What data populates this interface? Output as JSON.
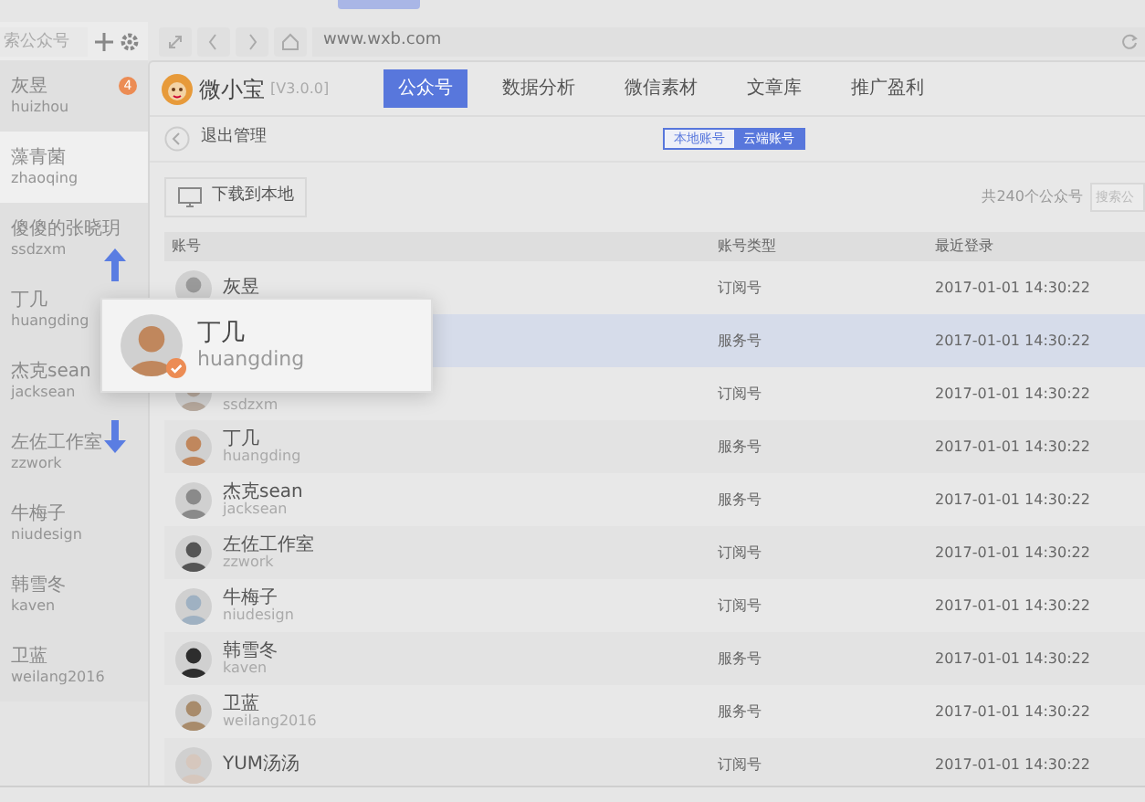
{
  "browser": {
    "url": "www.wxb.com"
  },
  "sidebar": {
    "search": {
      "placeholder": "索公众号"
    },
    "items": [
      {
        "name": "灰昱",
        "username": "huizhou",
        "badge": "4",
        "selected": false
      },
      {
        "name": "藻青菌",
        "username": "zhaoqing",
        "selected": true
      },
      {
        "name": "傻傻的张晓玥",
        "username": "ssdzxm",
        "selected": false
      },
      {
        "name": "丁几",
        "username": "huangding",
        "selected": false
      },
      {
        "name": "杰克sean",
        "username": "jacksean",
        "selected": false
      },
      {
        "name": "左佐工作室",
        "username": "zzwork",
        "selected": false
      },
      {
        "name": "牛梅子",
        "username": "niudesign",
        "selected": false
      },
      {
        "name": "韩雪冬",
        "username": "kaven",
        "selected": false
      },
      {
        "name": "卫蓝",
        "username": "weilang2016",
        "selected": false
      }
    ]
  },
  "app": {
    "name": "微小宝",
    "version": "[V3.0.0]",
    "tabs": [
      {
        "label": "公众号",
        "selected": true
      },
      {
        "label": "数据分析",
        "selected": false
      },
      {
        "label": "微信素材",
        "selected": false
      },
      {
        "label": "文章库",
        "selected": false
      },
      {
        "label": "推广盈利",
        "selected": false
      }
    ],
    "back_label": "退出管理",
    "toggle": [
      {
        "label": "本地账号",
        "selected": false
      },
      {
        "label": "云端账号",
        "selected": true
      }
    ],
    "download_button": "下载到本地",
    "count": "共240个公众号",
    "search": {
      "placeholder": "搜索公"
    },
    "table": {
      "columns": [
        "账号",
        "账号类型",
        "最近登录"
      ],
      "rows": [
        {
          "name": "灰昱",
          "type": "订阅号",
          "last_login": "2017-01-01 14:30:22",
          "selected": false
        },
        {
          "type": "服务号",
          "last_login": "2017-01-01 14:30:22",
          "selected": true
        },
        {
          "username": "ssdzxm",
          "type": "订阅号",
          "last_login": "2017-01-01 14:30:22",
          "selected": false
        },
        {
          "name": "丁几",
          "username": "huangding",
          "type": "服务号",
          "last_login": "2017-01-01 14:30:22",
          "selected": false
        },
        {
          "name": "杰克sean",
          "username": "jacksean",
          "type": "服务号",
          "last_login": "2017-01-01 14:30:22",
          "selected": false
        },
        {
          "name": "左佐工作室",
          "username": "zzwork",
          "type": "订阅号",
          "last_login": "2017-01-01 14:30:22",
          "selected": false
        },
        {
          "name": "牛梅子",
          "username": "niudesign",
          "type": "订阅号",
          "last_login": "2017-01-01 14:30:22",
          "selected": false
        },
        {
          "name": "韩雪冬",
          "username": "kaven",
          "type": "服务号",
          "last_login": "2017-01-01 14:30:22",
          "selected": false
        },
        {
          "name": "卫蓝",
          "username": "weilang2016",
          "type": "服务号",
          "last_login": "2017-01-01 14:30:22",
          "selected": false
        },
        {
          "name": "YUM汤汤",
          "type": "订阅号",
          "last_login": "2017-01-01 14:30:22",
          "selected": false
        }
      ]
    }
  },
  "drag_card": {
    "name": "丁几",
    "username": "huangding",
    "checked": true
  }
}
